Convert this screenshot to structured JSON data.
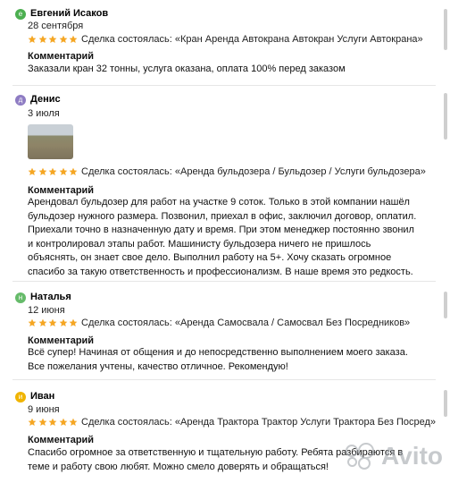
{
  "reviews": [
    {
      "avatar_letter": "e",
      "avatar_color": "#4caf50",
      "name": "Евгений Исаков",
      "date": "28 сентября",
      "rating": 5,
      "deal": "Сделка состоялась: «Кран Аренда Автокрана Автокран Услуги Автокрана»",
      "comment_title": "Комментарий",
      "comment": "Заказали кран 32 тонны, услуга оказана, оплата 100% перед заказом"
    },
    {
      "avatar_letter": "д",
      "avatar_color": "#8e7cc3",
      "name": "Денис",
      "date": "3 июля",
      "rating": 5,
      "deal": "Сделка состоялась: «Аренда бульдозера / Бульдозер / Услуги бульдозера»",
      "comment_title": "Комментарий",
      "comment": "Арендовал бульдозер для работ на участке 9 соток. Только в этой компании нашёл бульдозер нужного размера. Позвонил, приехал в офис, заключил договор, оплатил. Приехали точно в назначенную дату и время. При этом менеджер постоянно звонил и контролировал этапы работ. Машинисту бульдозера ничего не пришлось объяснять, он знает свое дело. Выполнил работу на 5+. Хочу сказать огромное спасибо за такую ответственность и профессионализм. В наше время это редкость."
    },
    {
      "avatar_letter": "н",
      "avatar_color": "#66bb6a",
      "name": "Наталья",
      "date": "12 июня",
      "rating": 5,
      "deal": "Сделка состоялась: «Аренда Самосвала / Самосвал Без Посредников»",
      "comment_title": "Комментарий",
      "comment": "Всё супер! Начиная от общения и до непосредственно выполнением моего заказа. Все пожелания учтены, качество отличное. Рекомендую!"
    },
    {
      "avatar_letter": "и",
      "avatar_color": "#f0b400",
      "name": "Иван",
      "date": "9 июня",
      "rating": 5,
      "deal": "Сделка состоялась: «Аренда Трактора Трактор Услуги Трактора Без Посред»",
      "comment_title": "Комментарий",
      "comment": "Спасибо огромное за ответственную и тщательную работу. Ребята разбираются в теме и работу свою любят. Можно смело доверять и обращаться!"
    }
  ],
  "colors": {
    "star": "#f5a623",
    "divider": "#e6e6e6"
  },
  "watermark": {
    "text": "Avito"
  }
}
